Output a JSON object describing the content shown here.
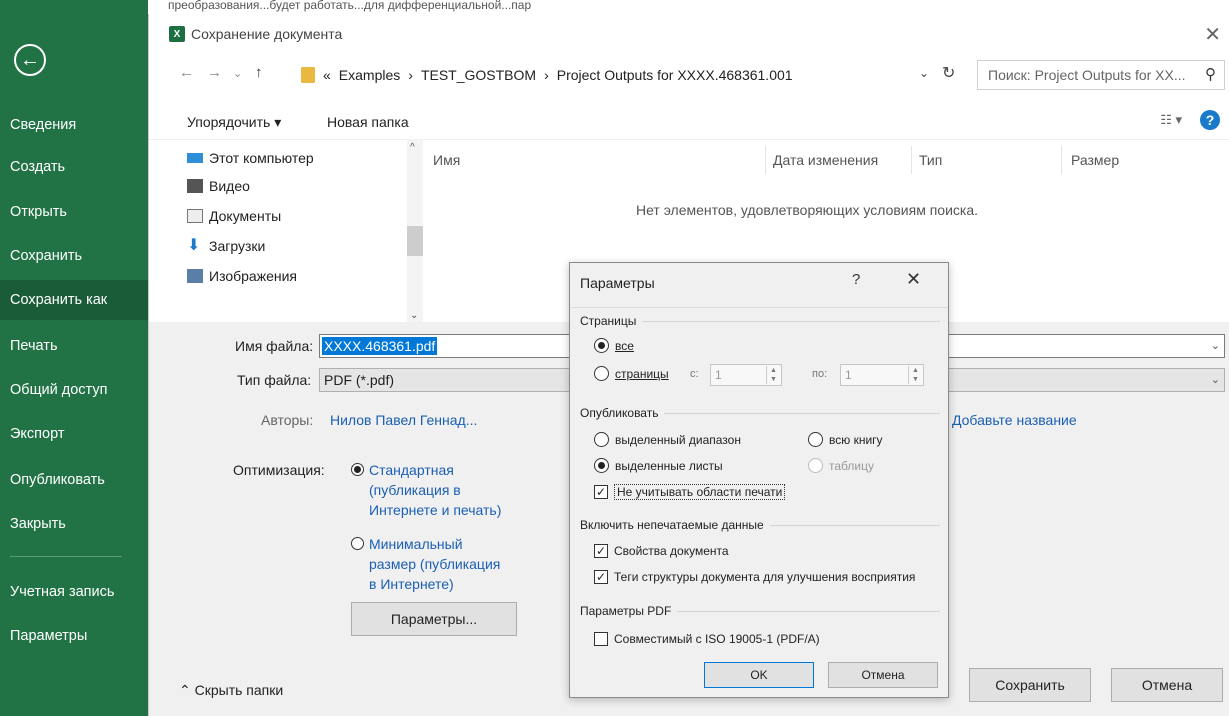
{
  "window": {
    "top_text": "преобразования...будет работать...для дифференциальной...пар"
  },
  "backstage": {
    "back_icon": "back-arrow-icon",
    "items": [
      "Сведения",
      "Создать",
      "Открыть",
      "Сохранить",
      "Сохранить как",
      "Печать",
      "Общий доступ",
      "Экспорт",
      "Опубликовать",
      "Закрыть",
      "Учетная запись",
      "Параметры"
    ],
    "active": "Сохранить как",
    "accent": "#217346"
  },
  "save_dialog": {
    "title": "Сохранение документа",
    "path": {
      "prefix": "«",
      "segments": [
        "Examples",
        "TEST_GOSTBOM",
        "Project Outputs for XXXX.468361.001"
      ]
    },
    "search_placeholder": "Поиск: Project Outputs for XX...",
    "toolbar": {
      "organize": "Упорядочить ▾",
      "new_folder": "Новая папка",
      "help": "?"
    },
    "nav_tree": [
      "Этот компьютер",
      "Видео",
      "Документы",
      "Загрузки",
      "Изображения"
    ],
    "columns": [
      "Имя",
      "Дата изменения",
      "Тип",
      "Размер"
    ],
    "empty_message": "Нет элементов, удовлетворяющих условиям поиска.",
    "file_name_label": "Имя файла:",
    "file_name_value": "XXXX.468361.pdf",
    "file_type_label": "Тип файла:",
    "file_type_value": "PDF (*.pdf)",
    "authors_label": "Авторы:",
    "authors_value": "Нилов Павел Геннад...",
    "title_placeholder": "Добавьте название",
    "optimization_label": "Оптимизация:",
    "opt_standard_lines": [
      "Стандартная",
      "(публикация в",
      "Интернете и печать)"
    ],
    "opt_minimal_lines": [
      "Минимальный",
      "размер (публикация",
      "в Интернете)"
    ],
    "options_button": "Параметры...",
    "hide_folders": "Скрыть папки",
    "save_button": "Сохранить",
    "cancel_button": "Отмена"
  },
  "options_dialog": {
    "title": "Параметры",
    "help": "?",
    "close": "✕",
    "pages_group": "Страницы",
    "pages_all": "все",
    "pages_range": "страницы",
    "from_label": "с:",
    "from_value": "1",
    "to_label": "по:",
    "to_value": "1",
    "publish_group": "Опубликовать",
    "publish_selection": "выделенный диапазон",
    "publish_workbook": "всю книгу",
    "publish_sheets": "выделенные листы",
    "publish_table": "таблицу",
    "ignore_print_areas": "Не учитывать области печати",
    "nonprint_group": "Включить непечатаемые данные",
    "doc_properties": "Свойства документа",
    "structure_tags": "Теги структуры документа для улучшения восприятия",
    "pdf_group": "Параметры PDF",
    "iso_compliant": "Совместимый с ISO 19005-1 (PDF/A)",
    "ok": "OK",
    "cancel": "Отмена"
  }
}
